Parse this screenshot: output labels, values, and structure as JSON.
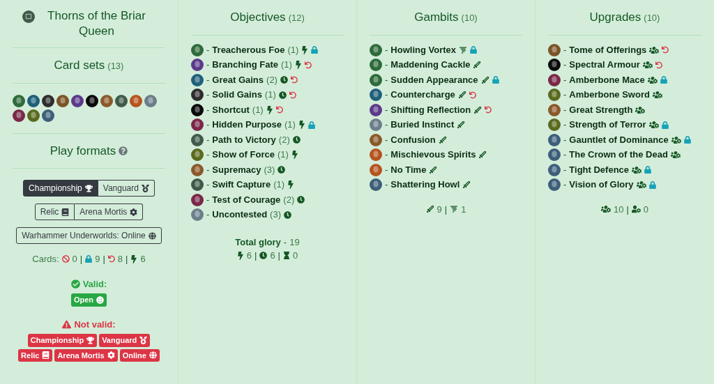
{
  "separator": "-",
  "divider": "|",
  "warband": {
    "title": "Thorns of the Briar Queen"
  },
  "card_sets": {
    "title": "Card sets",
    "count": "(13)",
    "sets": [
      {
        "color": "#2e6b3a"
      },
      {
        "color": "#1f5f7a"
      },
      {
        "color": "#2d2d2d"
      },
      {
        "color": "#7a5426"
      },
      {
        "color": "#5b3a8a"
      },
      {
        "color": "#0a0a0a"
      },
      {
        "color": "#8a5a2a"
      },
      {
        "color": "#3f5a4a"
      },
      {
        "color": "#b5541e"
      },
      {
        "color": "#6b7f8a"
      },
      {
        "color": "#7a2848"
      },
      {
        "color": "#5a6a1e"
      },
      {
        "color": "#3d5f7a"
      }
    ]
  },
  "play_formats": {
    "title": "Play formats",
    "groups": [
      [
        {
          "label": "Championship",
          "kind": "trophy",
          "selected": true
        },
        {
          "label": "Vanguard",
          "kind": "medal",
          "selected": false
        }
      ],
      [
        {
          "label": "Relic",
          "kind": "book",
          "selected": false
        },
        {
          "label": "Arena Mortis",
          "kind": "cog",
          "selected": false
        }
      ],
      [
        {
          "label": "Warhammer Underworlds: Online",
          "kind": "globe",
          "selected": false
        }
      ]
    ]
  },
  "cards_summary": {
    "label": "Cards:",
    "items": [
      {
        "kind": "banned",
        "value": "0"
      },
      {
        "kind": "lock",
        "value": "9"
      },
      {
        "kind": "rotated",
        "value": "8"
      },
      {
        "kind": "surge",
        "value": "6"
      }
    ]
  },
  "valid": {
    "title": "Valid:",
    "badges": [
      {
        "label": "Open",
        "kind": "smile"
      }
    ]
  },
  "not_valid": {
    "title": "Not valid:",
    "badges": [
      {
        "label": "Championship",
        "kind": "trophy"
      },
      {
        "label": "Vanguard",
        "kind": "medal"
      },
      {
        "label": "Relic",
        "kind": "book"
      },
      {
        "label": "Arena Mortis",
        "kind": "cog"
      },
      {
        "label": "Online",
        "kind": "globe"
      }
    ]
  },
  "objectives": {
    "title": "Objectives",
    "count": "(12)",
    "cards": [
      {
        "name": "Treacherous Foe",
        "glory": "(1)",
        "kind": "surge",
        "color": "#2e6b3a",
        "lock": true,
        "rotated": false
      },
      {
        "name": "Branching Fate",
        "glory": "(1)",
        "kind": "surge",
        "color": "#5b3a8a",
        "lock": false,
        "rotated": true
      },
      {
        "name": "Great Gains",
        "glory": "(2)",
        "kind": "end",
        "color": "#1f5f7a",
        "lock": false,
        "rotated": true
      },
      {
        "name": "Solid Gains",
        "glory": "(1)",
        "kind": "end",
        "color": "#2d2d2d",
        "lock": false,
        "rotated": true
      },
      {
        "name": "Shortcut",
        "glory": "(1)",
        "kind": "surge",
        "color": "#0a0a0a",
        "lock": false,
        "rotated": true
      },
      {
        "name": "Hidden Purpose",
        "glory": "(1)",
        "kind": "surge",
        "color": "#7a2848",
        "lock": true,
        "rotated": false
      },
      {
        "name": "Path to Victory",
        "glory": "(2)",
        "kind": "end",
        "color": "#3f5a4a",
        "lock": false,
        "rotated": false
      },
      {
        "name": "Show of Force",
        "glory": "(1)",
        "kind": "surge",
        "color": "#5a6a1e",
        "lock": false,
        "rotated": false
      },
      {
        "name": "Supremacy",
        "glory": "(3)",
        "kind": "end",
        "color": "#8a5a2a",
        "lock": false,
        "rotated": false
      },
      {
        "name": "Swift Capture",
        "glory": "(1)",
        "kind": "surge",
        "color": "#3f5a4a",
        "lock": false,
        "rotated": false
      },
      {
        "name": "Test of Courage",
        "glory": "(2)",
        "kind": "end",
        "color": "#7a2848",
        "lock": false,
        "rotated": false
      },
      {
        "name": "Uncontested",
        "glory": "(3)",
        "kind": "end",
        "color": "#6b7f8a",
        "lock": false,
        "rotated": false
      }
    ],
    "total_label": "Total glory",
    "total_value": "19",
    "counts": [
      {
        "kind": "surge",
        "value": "6"
      },
      {
        "kind": "end",
        "value": "6"
      },
      {
        "kind": "hourglass",
        "value": "0"
      }
    ]
  },
  "gambits": {
    "title": "Gambits",
    "count": "(10)",
    "cards": [
      {
        "name": "Howling Vortex",
        "kind": "spell",
        "color": "#2e6b3a",
        "lock": true,
        "rotated": false
      },
      {
        "name": "Maddening Cackle",
        "kind": "ploy",
        "color": "#2e6b3a",
        "lock": false,
        "rotated": false
      },
      {
        "name": "Sudden Appearance",
        "kind": "ploy",
        "color": "#2e6b3a",
        "lock": true,
        "rotated": false
      },
      {
        "name": "Countercharge",
        "kind": "ploy",
        "color": "#1f5f7a",
        "lock": false,
        "rotated": true
      },
      {
        "name": "Shifting Reflection",
        "kind": "ploy",
        "color": "#5b3a8a",
        "lock": false,
        "rotated": true
      },
      {
        "name": "Buried Instinct",
        "kind": "ploy",
        "color": "#6b7f8a",
        "lock": false,
        "rotated": false
      },
      {
        "name": "Confusion",
        "kind": "ploy",
        "color": "#8a5a2a",
        "lock": false,
        "rotated": false
      },
      {
        "name": "Mischievous Spirits",
        "kind": "ploy",
        "color": "#b5541e",
        "lock": false,
        "rotated": false
      },
      {
        "name": "No Time",
        "kind": "ploy",
        "color": "#b5541e",
        "lock": false,
        "rotated": false
      },
      {
        "name": "Shattering Howl",
        "kind": "ploy",
        "color": "#3d5f7a",
        "lock": false,
        "rotated": false
      }
    ],
    "counts": [
      {
        "kind": "ploy",
        "value": "9"
      },
      {
        "kind": "spell",
        "value": "1"
      }
    ]
  },
  "upgrades": {
    "title": "Upgrades",
    "count": "(10)",
    "cards": [
      {
        "name": "Tome of Offerings",
        "kind": "upgrade",
        "color": "#7a5426",
        "lock": false,
        "rotated": true
      },
      {
        "name": "Spectral Armour",
        "kind": "upgrade",
        "color": "#0a0a0a",
        "lock": false,
        "rotated": true
      },
      {
        "name": "Amberbone Mace",
        "kind": "upgrade",
        "color": "#7a2848",
        "lock": true,
        "rotated": false
      },
      {
        "name": "Amberbone Sword",
        "kind": "upgrade",
        "color": "#5a6a1e",
        "lock": false,
        "rotated": false
      },
      {
        "name": "Great Strength",
        "kind": "upgrade",
        "color": "#8a5a2a",
        "lock": false,
        "rotated": false
      },
      {
        "name": "Strength of Terror",
        "kind": "upgrade",
        "color": "#5a6a1e",
        "lock": true,
        "rotated": false
      },
      {
        "name": "Gauntlet of Dominance",
        "kind": "upgrade",
        "color": "#3d5f7a",
        "lock": true,
        "rotated": false
      },
      {
        "name": "The Crown of the Dead",
        "kind": "upgrade",
        "color": "#3d5f7a",
        "lock": false,
        "rotated": false
      },
      {
        "name": "Tight Defence",
        "kind": "upgrade",
        "color": "#3d5f7a",
        "lock": true,
        "rotated": false
      },
      {
        "name": "Vision of Glory",
        "kind": "upgrade",
        "color": "#3d5f7a",
        "lock": true,
        "rotated": false
      }
    ],
    "counts": [
      {
        "kind": "upgrade",
        "value": "10"
      },
      {
        "kind": "user-upgrade",
        "value": "0"
      }
    ]
  }
}
